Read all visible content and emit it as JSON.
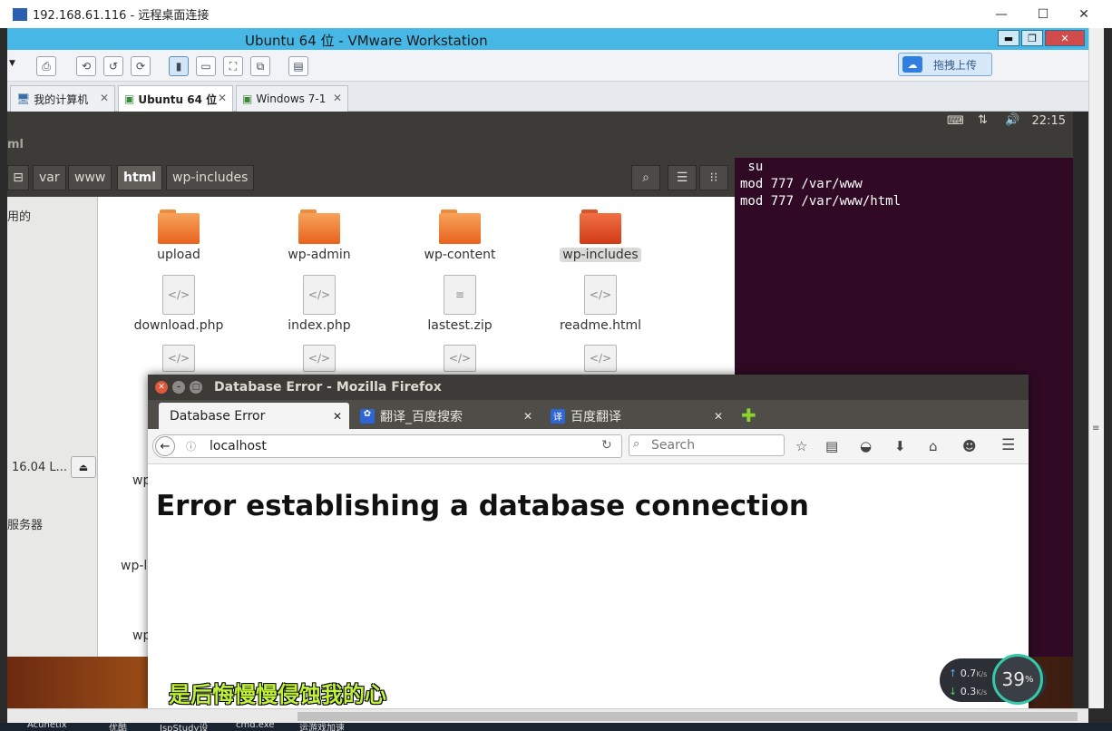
{
  "rdp": {
    "title": "192.168.61.116 - 远程桌面连接",
    "minimize": "—",
    "maximize": "☐",
    "close": "✕"
  },
  "vmware": {
    "title": "Ubuntu 64 位 - VMware Workstation",
    "upload_label": "拖拽上传",
    "tabs": [
      {
        "label": "我的计算机"
      },
      {
        "label": "Ubuntu 64 位"
      },
      {
        "label": "Windows 7-1"
      }
    ]
  },
  "ubuntu": {
    "time": "22:15",
    "nautilus": {
      "title_fragment": "ml",
      "breadcrumbs": [
        "var",
        "www",
        "html",
        "wp-includes"
      ],
      "sidebar": [
        "用的",
        "16.04 L...",
        "服务器"
      ],
      "files": [
        {
          "name": "upload",
          "kind": "folder"
        },
        {
          "name": "wp-admin",
          "kind": "folder"
        },
        {
          "name": "wp-content",
          "kind": "folder"
        },
        {
          "name": "wp-includes",
          "kind": "folder-selected"
        },
        {
          "name": "download.php",
          "kind": "code"
        },
        {
          "name": "index.php",
          "kind": "code"
        },
        {
          "name": "lastest.zip",
          "kind": "text"
        },
        {
          "name": "readme.html",
          "kind": "code"
        }
      ],
      "partial_labels": [
        "wp",
        "wp-l",
        "wp"
      ]
    },
    "terminal": {
      "lines": [
        " su",
        "",
        "mod 777 /var/www",
        "mod 777 /var/www/html"
      ]
    }
  },
  "firefox": {
    "title": "Database Error - Mozilla Firefox",
    "tabs": [
      {
        "label": "Database Error"
      },
      {
        "label": "翻译_百度搜索"
      },
      {
        "label": "百度翻译"
      }
    ],
    "url": "localhost",
    "search_placeholder": "Search",
    "heading": "Error establishing a database connection"
  },
  "overlay": {
    "subtitle": "是后悔慢慢侵蚀我的心",
    "net_up": "0.7",
    "net_down": "0.3",
    "net_unit": "K/s",
    "cpu_percent": "39",
    "pct_sign": "%"
  },
  "taskbar": [
    "Acunetix",
    "优酷",
    "JspStudy设",
    "cmd.exe",
    "运游戏加速"
  ]
}
